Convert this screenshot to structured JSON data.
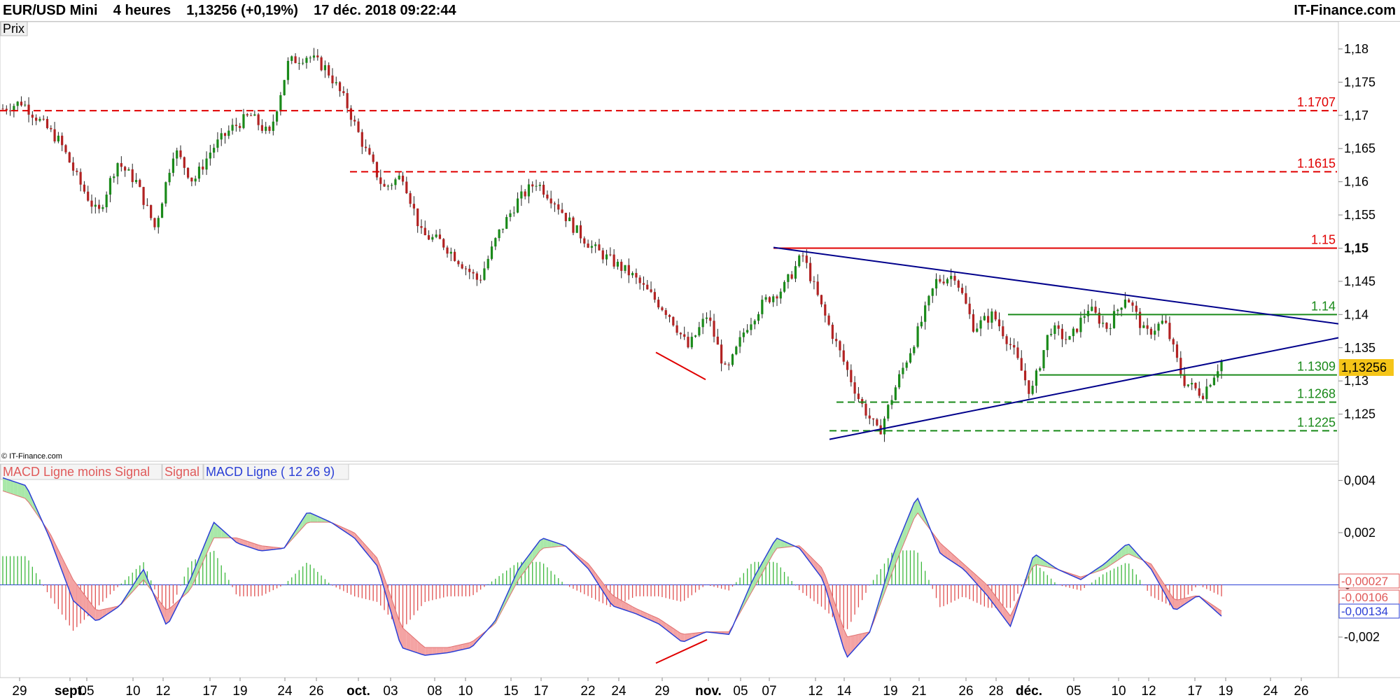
{
  "header": {
    "symbol": "EUR/USD Mini",
    "timeframe": "4 heures",
    "price": "1,13256",
    "change": "(+0,19%)",
    "datetime": "17 déc. 2018 09:22:44",
    "brand": "IT-Finance.com"
  },
  "price_panel": {
    "label": "Prix",
    "copyright": "© IT-Finance.com",
    "current_price_tag": "1,13256"
  },
  "macd_panel": {
    "legend": [
      "MACD Ligne moins Signal",
      "Signal",
      "MACD Ligne ( 12 26 9)"
    ],
    "value_tags": [
      "-0,00027",
      "-0,00106",
      "-0,00134"
    ]
  },
  "colors": {
    "up_candle": "#1a8a1a",
    "down_candle": "#b22222",
    "resistance": "#e00000",
    "support": "#1a8a1a",
    "trendline": "#00008b",
    "macd_line": "#2b3fd6",
    "signal_fill_down": "#f4a3a3",
    "signal_fill_up": "#a9e8a9",
    "price_tag": "#f5c518"
  },
  "chart_data": [
    {
      "type": "candlestick",
      "title": "EUR/USD Mini",
      "ylim": [
        1.118,
        1.184
      ],
      "y_ticks": [
        "1,125",
        "1,13",
        "1,135",
        "1,14",
        "1,145",
        "1,15",
        "1,155",
        "1,16",
        "1,165",
        "1,17",
        "1,175",
        "1,18"
      ],
      "y_tick_values": [
        1.125,
        1.13,
        1.135,
        1.14,
        1.145,
        1.15,
        1.155,
        1.16,
        1.165,
        1.17,
        1.175,
        1.18
      ],
      "x_ticks": [
        "29",
        "sept.",
        "05",
        "10",
        "12",
        "17",
        "19",
        "24",
        "26",
        "oct.",
        "03",
        "08",
        "10",
        "15",
        "17",
        "22",
        "24",
        "29",
        "nov.",
        "05",
        "07",
        "12",
        "14",
        "19",
        "21",
        "26",
        "28",
        "déc.",
        "05",
        "10",
        "12",
        "17",
        "19",
        "24",
        "26"
      ],
      "close_path": [
        1.171,
        1.172,
        1.169,
        1.166,
        1.16,
        1.155,
        1.163,
        1.16,
        1.153,
        1.165,
        1.16,
        1.165,
        1.168,
        1.17,
        1.167,
        1.178,
        1.179,
        1.177,
        1.172,
        1.165,
        1.159,
        1.161,
        1.152,
        1.151,
        1.148,
        1.145,
        1.152,
        1.157,
        1.16,
        1.157,
        1.153,
        1.15,
        1.148,
        1.146,
        1.143,
        1.14,
        1.135,
        1.14,
        1.131,
        1.138,
        1.142,
        1.144,
        1.149,
        1.141,
        1.134,
        1.127,
        1.122,
        1.13,
        1.137,
        1.145,
        1.146,
        1.138,
        1.14,
        1.135,
        1.128,
        1.138,
        1.136,
        1.141,
        1.138,
        1.143,
        1.137,
        1.139,
        1.13,
        1.128,
        1.133
      ],
      "horizontal_levels": [
        {
          "label": "1.1707",
          "value": 1.1707,
          "style": "dashed",
          "color": "#e00000"
        },
        {
          "label": "1.1615",
          "value": 1.1615,
          "style": "dashed",
          "color": "#e00000"
        },
        {
          "label": "1.15",
          "value": 1.15,
          "style": "solid",
          "color": "#e00000"
        },
        {
          "label": "1.14",
          "value": 1.14,
          "style": "solid",
          "color": "#1a8a1a"
        },
        {
          "label": "1.1309",
          "value": 1.1309,
          "style": "solid",
          "color": "#1a8a1a"
        },
        {
          "label": "1.1268",
          "value": 1.1268,
          "style": "dashed",
          "color": "#1a8a1a"
        },
        {
          "label": "1.1225",
          "value": 1.1225,
          "style": "dashed",
          "color": "#1a8a1a"
        }
      ],
      "last_price": 1.13256
    },
    {
      "type": "macd",
      "params": "12 26 9",
      "ylim": [
        -0.0035,
        0.0046
      ],
      "y_ticks": [
        "0,004",
        "0,002",
        "0",
        "-0,002"
      ],
      "y_tick_values": [
        0.004,
        0.002,
        0,
        -0.002
      ],
      "macd_path": [
        0.0041,
        0.0038,
        0.0018,
        -0.0006,
        -0.0014,
        -0.0008,
        0.0006,
        -0.0016,
        0.0002,
        0.0024,
        0.0016,
        0.0013,
        0.0014,
        0.0028,
        0.0024,
        0.0018,
        0.0007,
        -0.0024,
        -0.0027,
        -0.0026,
        -0.0024,
        -0.0014,
        0.0006,
        0.0018,
        0.0015,
        0.0006,
        -0.0008,
        -0.0011,
        -0.0015,
        -0.0022,
        -0.0018,
        -0.0019,
        0.0002,
        0.0018,
        0.0014,
        0.0002,
        -0.0028,
        -0.0018,
        0.0012,
        0.0034,
        0.0012,
        0.0006,
        -0.0004,
        -0.0016,
        0.0012,
        0.0006,
        0.0002,
        0.0008,
        0.0016,
        0.0006,
        -0.001,
        -0.0004,
        -0.0012
      ],
      "signal_path": [
        0.0036,
        0.0033,
        0.002,
        0.0002,
        -0.001,
        -0.0008,
        0.0002,
        -0.001,
        -0.0002,
        0.0018,
        0.0018,
        0.0015,
        0.0014,
        0.0024,
        0.0024,
        0.002,
        0.001,
        -0.0016,
        -0.0024,
        -0.0024,
        -0.0022,
        -0.0015,
        0.0002,
        0.0014,
        0.0015,
        0.0008,
        -0.0004,
        -0.0009,
        -0.0013,
        -0.0019,
        -0.0018,
        -0.0018,
        -0.0002,
        0.0014,
        0.0015,
        0.0006,
        -0.002,
        -0.0018,
        0.0006,
        0.0028,
        0.0016,
        0.0008,
        0.0,
        -0.0012,
        0.0008,
        0.0006,
        0.0003,
        0.0006,
        0.0012,
        0.0008,
        -0.0006,
        -0.0004,
        -0.001
      ],
      "last_values": {
        "histogram": -0.00027,
        "signal": -0.00106,
        "macd": -0.00134
      }
    }
  ]
}
